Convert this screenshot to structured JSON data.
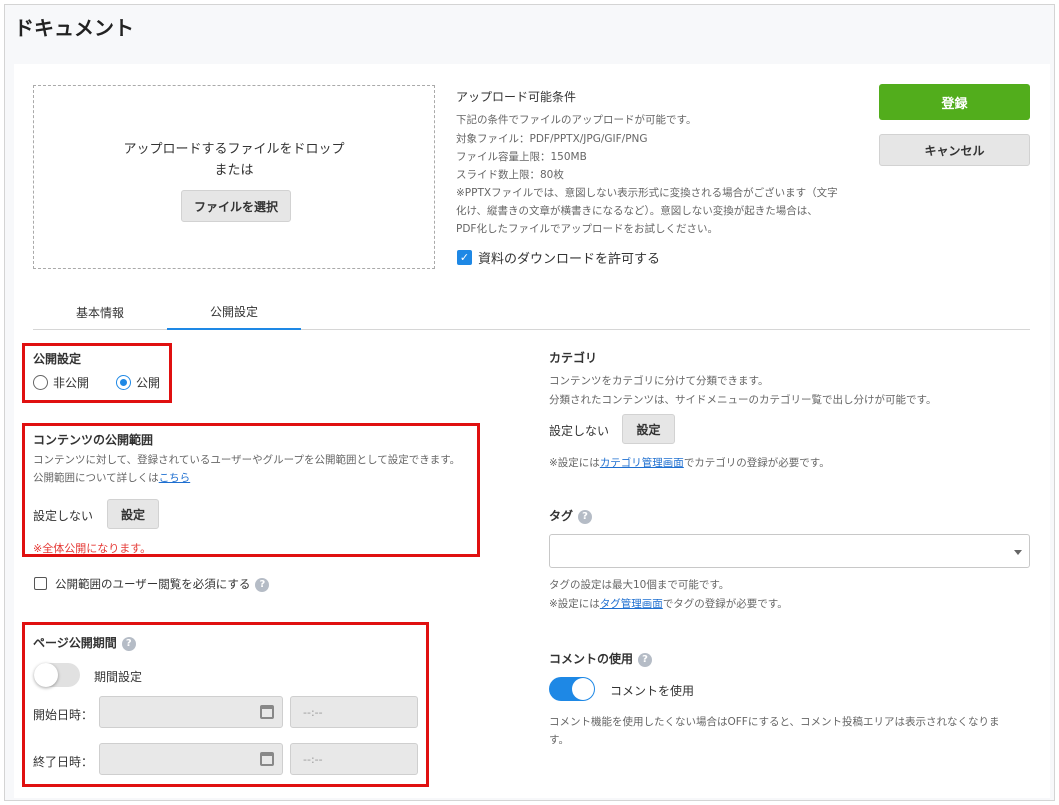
{
  "page": {
    "title": "ドキュメント"
  },
  "upload": {
    "drop_text": "アップロードするファイルをドロップ",
    "or_text": "または",
    "select_button": "ファイルを選択",
    "conditions_title": "アップロード可能条件",
    "conditions": [
      "下記の条件でファイルのアップロードが可能です。",
      "対象ファイル：PDF/PPTX/JPG/GIF/PNG",
      "ファイル容量上限：150MB",
      "スライド数上限：80枚",
      "※PPTXファイルでは、意図しない表示形式に変換される場合がございます（文字",
      "化け、縦書きの文章が横書きになるなど）。意図しない変換が起きた場合は、",
      "PDF化したファイルでアップロードをお試しください。"
    ],
    "allow_download_label": "資料のダウンロードを許可する",
    "allow_download_checked": true
  },
  "actions": {
    "register": "登録",
    "cancel": "キャンセル"
  },
  "colors": {
    "accent": "#1e88e5",
    "register": "#52ad1c",
    "highlight": "#e01010",
    "warning_text": "#e53935"
  },
  "tabs": [
    {
      "label": "基本情報",
      "active": false
    },
    {
      "label": "公開設定",
      "active": true
    }
  ],
  "publish": {
    "title": "公開設定",
    "option_private": "非公開",
    "option_public": "公開",
    "selected": "公開"
  },
  "scope": {
    "title": "コンテンツの公開範囲",
    "desc": "コンテンツに対して、登録されているユーザーやグループを公開範囲として設定できます。",
    "more_prefix": "公開範囲について詳しくは",
    "more_link": "こちら",
    "value": "設定しない",
    "button": "設定",
    "warning": "※全体公開になります。"
  },
  "require_view": {
    "label": "公開範囲のユーザー閲覧を必須にする",
    "checked": false
  },
  "period": {
    "title": "ページ公開期間",
    "toggle_label": "期間設定",
    "toggle_on": false,
    "start_label": "開始日時：",
    "end_label": "終了日時：",
    "time_placeholder": "--:--"
  },
  "category": {
    "title": "カテゴリ",
    "desc1": "コンテンツをカテゴリに分けて分類できます。",
    "desc2": "分類されたコンテンツは、サイドメニューのカテゴリー覧で出し分けが可能です。",
    "value": "設定しない",
    "button": "設定",
    "note_prefix": "※設定には",
    "note_link": "カテゴリ管理画面",
    "note_suffix": "でカテゴリの登録が必要です。"
  },
  "tag": {
    "title": "タグ",
    "note1": "タグの設定は最大10個まで可能です。",
    "note_prefix": "※設定には",
    "note_link": "タグ管理画面",
    "note_suffix": "でタグの登録が必要です。"
  },
  "comment": {
    "title": "コメントの使用",
    "toggle_label": "コメントを使用",
    "toggle_on": true,
    "desc1": "コメント機能を使用したくない場合はOFFにすると、コメント投稿エリアは表示されなくなりま",
    "desc2": "す。"
  }
}
